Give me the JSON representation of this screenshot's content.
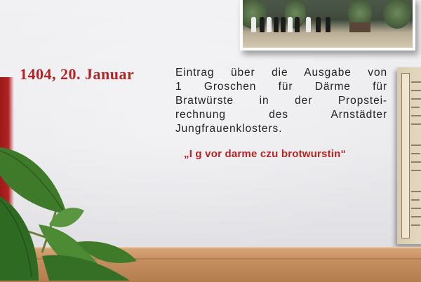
{
  "exhibit": {
    "date_heading": "1404, 20. Januar",
    "entry_lines": [
      "Eintrag über die Ausgabe von",
      "1 Groschen für Därme für",
      "Bratwürste in der Propstei-",
      "rechnung des Arnstädter",
      "Jungfrauenklosters."
    ],
    "quote": "„I g vor darme czu brotwurstin“"
  },
  "colors": {
    "accent_red": "#b02424",
    "wall": "#ebebee",
    "wood": "#c58f5f",
    "leaf": "#3f7a2a"
  }
}
